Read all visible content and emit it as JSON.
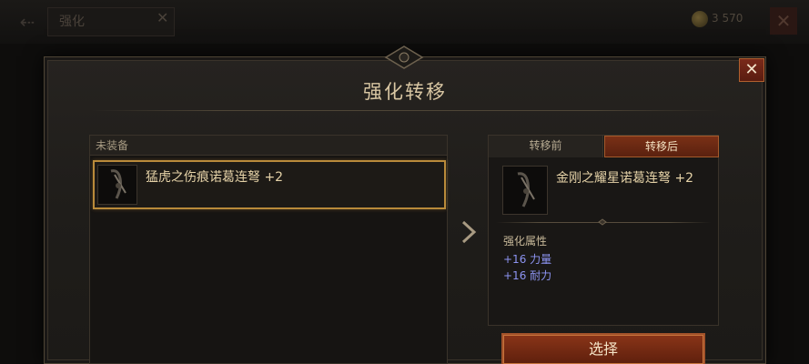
{
  "background": {
    "back_icon": "back-arrow-icon",
    "tab_label": "强化",
    "tab_close": "✕",
    "currency_text": "3 570",
    "close_icon": "close-icon"
  },
  "dialog": {
    "title": "强化转移",
    "close_icon": "close-icon",
    "close_glyph": "✕"
  },
  "left_panel": {
    "header": "未装备",
    "item": {
      "name": "猛虎之伤痕诺葛连弩 +2",
      "icon": "crossbow-icon"
    }
  },
  "right_panel": {
    "tabs": [
      {
        "label": "转移前",
        "selected": false
      },
      {
        "label": "转移后",
        "selected": true
      }
    ],
    "item": {
      "name": "金刚之耀星诺葛连弩 +2",
      "icon": "crossbow-icon"
    },
    "attributes_label": "强化属性",
    "attributes": [
      "+16 力量",
      "+16 耐力"
    ]
  },
  "select_button": "选择",
  "colors": {
    "accent_gold": "#b98a3a",
    "button_red": "#8a3518",
    "attribute_blue": "#8d94f2"
  }
}
